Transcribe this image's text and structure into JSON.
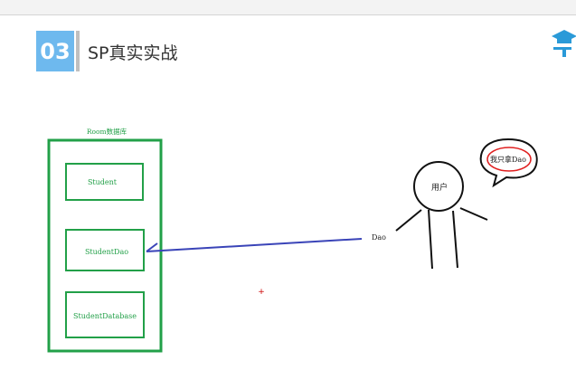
{
  "slide": {
    "number": "03",
    "title": "SP真实实战"
  },
  "diagram": {
    "database_label": "Room数据库",
    "boxes": [
      "Student",
      "StudentDao",
      "StudentDatabase"
    ],
    "arrow_label": "Dao",
    "user_label": "用户",
    "speech_bubble": "我只拿Dao",
    "marker": "+"
  },
  "colors": {
    "accent_blue": "#6eb9ee",
    "box_green": "#22a048",
    "arrow_blue": "#3a44b8",
    "bubble_red": "#e02020",
    "logo_blue": "#2a9ad8"
  }
}
